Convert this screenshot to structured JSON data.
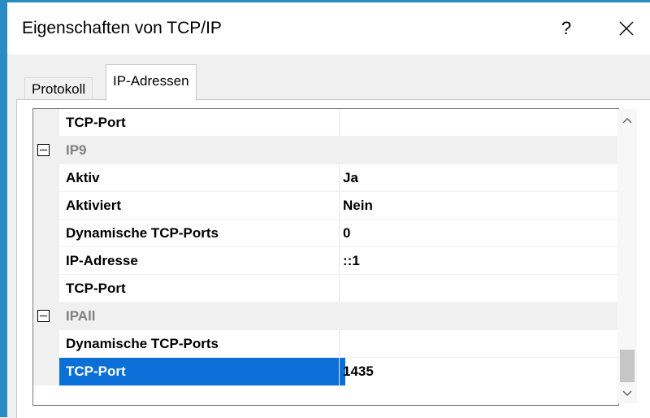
{
  "window": {
    "title": "Eigenschaften von TCP/IP",
    "help_glyph": "?",
    "close_icon": "close-icon"
  },
  "tabs": [
    {
      "label": "Protokoll",
      "active": false
    },
    {
      "label": "IP-Adressen",
      "active": true
    }
  ],
  "grid": {
    "rows": [
      {
        "type": "property",
        "name": "TCP-Port",
        "value": ""
      },
      {
        "type": "category",
        "name": "IP9"
      },
      {
        "type": "property",
        "name": "Aktiv",
        "value": "Ja"
      },
      {
        "type": "property",
        "name": "Aktiviert",
        "value": "Nein"
      },
      {
        "type": "property",
        "name": "Dynamische TCP-Ports",
        "value": "0"
      },
      {
        "type": "property",
        "name": "IP-Adresse",
        "value": "::1"
      },
      {
        "type": "property",
        "name": "TCP-Port",
        "value": ""
      },
      {
        "type": "category",
        "name": "IPAll"
      },
      {
        "type": "property",
        "name": "Dynamische TCP-Ports",
        "value": ""
      },
      {
        "type": "property",
        "name": "TCP-Port",
        "value": "1435",
        "selected": true
      }
    ]
  },
  "colors": {
    "window_border": "#2b8cc4",
    "selection": "#0a6fd6"
  }
}
